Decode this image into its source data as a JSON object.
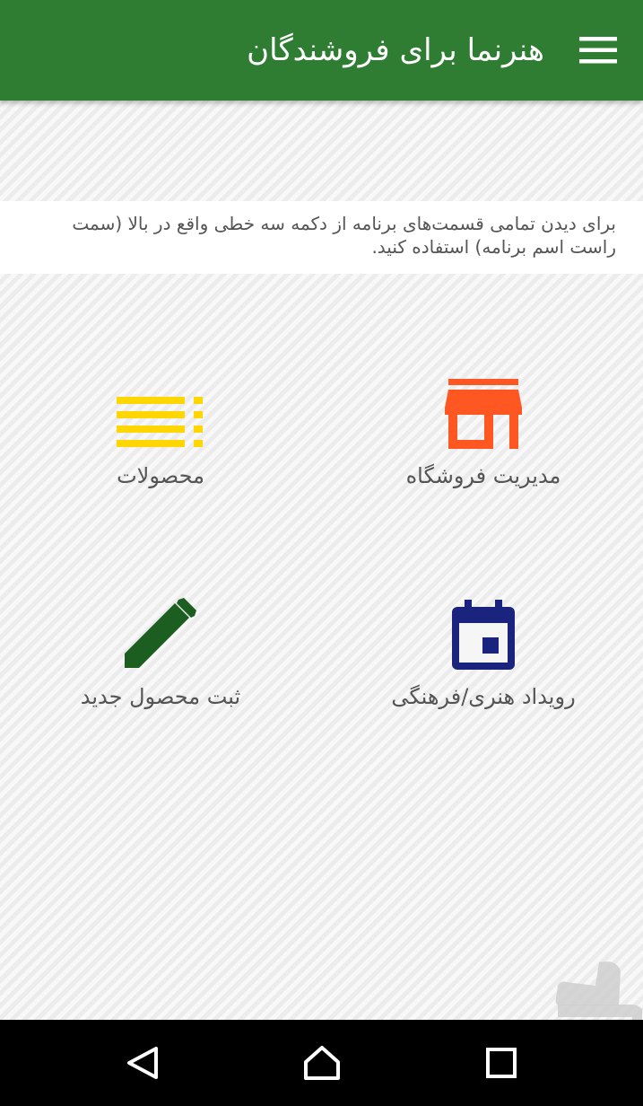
{
  "appbar": {
    "title": "هنرنما برای فروشندگان",
    "menu_icon": "hamburger-menu-icon",
    "color": "#2e7d32"
  },
  "hint": {
    "text": "برای دیدن تمامی قسمت‌های برنامه از دکمه سه خطی واقع در بالا (سمت راست اسم برنامه) استفاده کنید."
  },
  "tiles": [
    {
      "label": "مدیریت فروشگاه",
      "icon": "store-icon",
      "color": "#ff5722"
    },
    {
      "label": "محصولات",
      "icon": "product-list-icon",
      "color": "#ffd600"
    },
    {
      "label": "رویداد هنری/فرهنگی",
      "icon": "calendar-event-icon",
      "color": "#1a237e"
    },
    {
      "label": "ثبت محصول جدید",
      "icon": "pencil-icon",
      "color": "#1b5e20"
    }
  ],
  "navbar": {
    "back_icon": "back-triangle-icon",
    "home_icon": "home-icon",
    "recents_icon": "recents-square-icon"
  },
  "watermark": {
    "icon": "store-logo-watermark-icon"
  }
}
